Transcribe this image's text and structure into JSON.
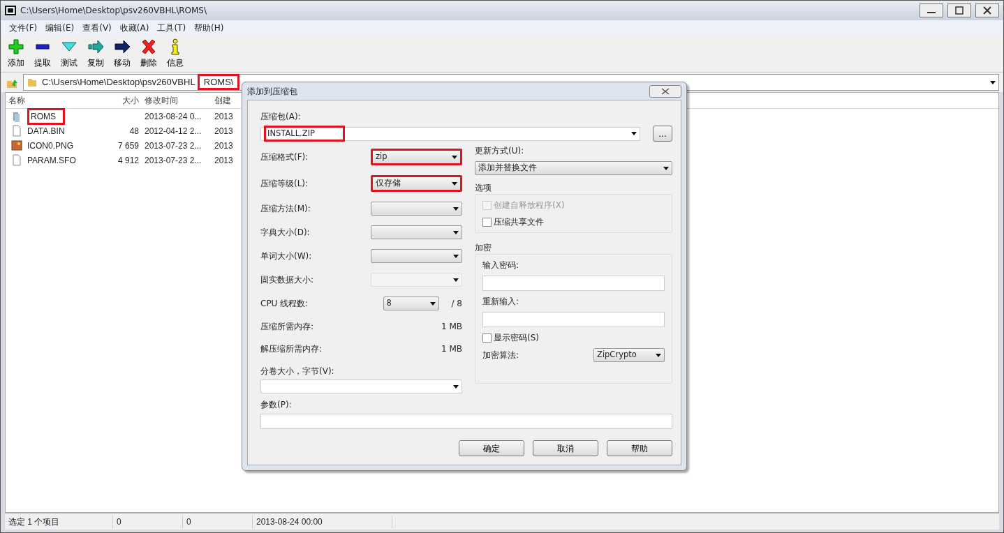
{
  "window": {
    "title": "C:\\Users\\Home\\Desktop\\psv260VBHL\\ROMS\\"
  },
  "menu": [
    "文件(F)",
    "编辑(E)",
    "查看(V)",
    "收藏(A)",
    "工具(T)",
    "帮助(H)"
  ],
  "toolbar": [
    {
      "label": "添加",
      "kind": "add"
    },
    {
      "label": "提取",
      "kind": "extract"
    },
    {
      "label": "测试",
      "kind": "test"
    },
    {
      "label": "复制",
      "kind": "copy"
    },
    {
      "label": "移动",
      "kind": "move"
    },
    {
      "label": "删除",
      "kind": "delete"
    },
    {
      "label": "信息",
      "kind": "info"
    }
  ],
  "address": {
    "segments": [
      {
        "text": "C:\\Users\\Home\\Desktop\\psv260VBHL",
        "highlighted": false
      },
      {
        "text": "ROMS\\",
        "highlighted": true
      }
    ]
  },
  "file_list": {
    "columns": [
      "名称",
      "大小",
      "修改时间",
      "创建"
    ],
    "rows": [
      {
        "name": "ROMS",
        "kind": "folder",
        "modified": "2013-08-24 0...",
        "created": "2013",
        "highlighted": true
      },
      {
        "name": "DATA.BIN",
        "kind": "file",
        "size": "48",
        "modified": "2012-04-12 2...",
        "created": "2013",
        "highlighted": false
      },
      {
        "name": "ICON0.PNG",
        "kind": "image",
        "size": "7 659",
        "modified": "2013-07-23 2...",
        "created": "2013",
        "highlighted": false
      },
      {
        "name": "PARAM.SFO",
        "kind": "file",
        "size": "4 912",
        "modified": "2013-07-23 2...",
        "created": "2013",
        "highlighted": false
      }
    ]
  },
  "status_bar": [
    "选定 1 个项目",
    "0",
    "0",
    "2013-08-24 00:00"
  ],
  "dialog": {
    "title": "添加到压缩包",
    "archive": {
      "label": "压缩包(A):",
      "value": "INSTALL.ZIP",
      "highlighted": true
    },
    "browse_button": "...",
    "settings": [
      {
        "kind": "combo",
        "label": "压缩格式(F):",
        "value": "zip",
        "highlighted": true,
        "disabled": false
      },
      {
        "kind": "combo",
        "label": "压缩等级(L):",
        "value": "仅存储",
        "highlighted": true,
        "disabled": false
      },
      {
        "kind": "combo",
        "label": "压缩方法(M):",
        "highlighted": false,
        "disabled": false
      },
      {
        "kind": "combo",
        "label": "字典大小(D):",
        "highlighted": false,
        "disabled": false
      },
      {
        "kind": "combo",
        "label": "单词大小(W):",
        "highlighted": false,
        "disabled": false
      },
      {
        "kind": "combo",
        "label": "固实数据大小:",
        "highlighted": false,
        "disabled": true
      },
      {
        "kind": "threads",
        "label": "CPU 线程数:",
        "value": "8",
        "suffix": "/ 8",
        "highlighted": false,
        "disabled": false
      },
      {
        "kind": "info",
        "label": "压缩所需内存:",
        "value": "1 MB"
      },
      {
        "kind": "info",
        "label": "解压缩所需内存:",
        "value": "1 MB"
      }
    ],
    "volume": {
      "label": "分卷大小，字节(V):"
    },
    "update_mode": {
      "label": "更新方式(U):",
      "value": "添加并替换文件"
    },
    "options": {
      "title": "选项",
      "checkboxes": [
        {
          "label": "创建自释放程序(X)",
          "checked": false,
          "disabled": true
        },
        {
          "label": "压缩共享文件",
          "checked": false,
          "disabled": false
        }
      ]
    },
    "encryption": {
      "title": "加密",
      "password_label": "输入密码:",
      "reenter_label": "重新输入:",
      "show_password": {
        "label": "显示密码(S)",
        "checked": false,
        "disabled": false
      },
      "method_label": "加密算法:",
      "method_value": "ZipCrypto"
    },
    "params": {
      "label": "参数(P):"
    },
    "buttons": [
      "确定",
      "取消",
      "帮助"
    ]
  }
}
